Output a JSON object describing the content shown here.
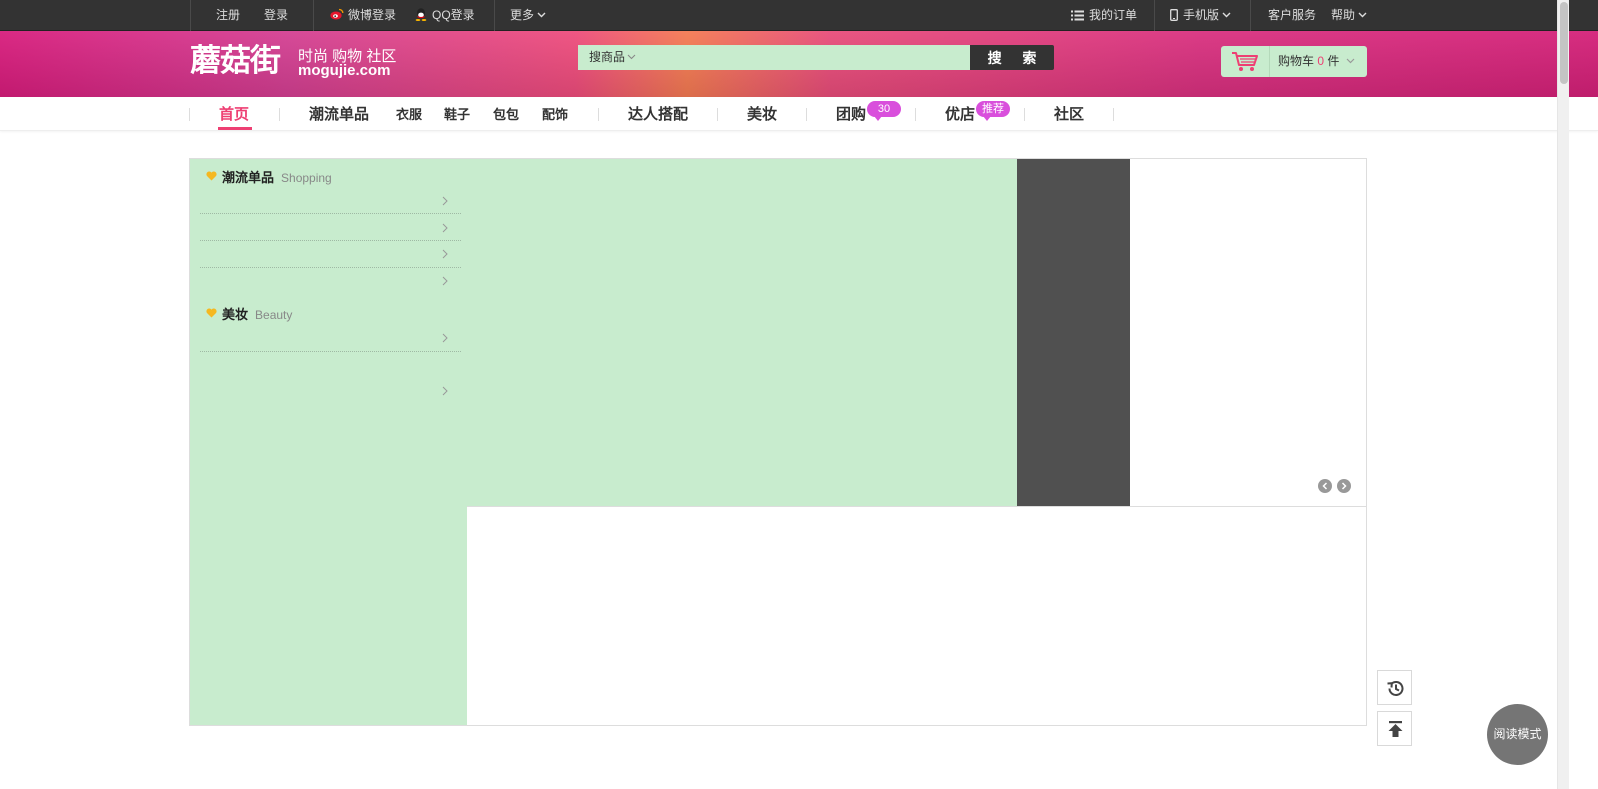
{
  "topbar": {
    "register": "注册",
    "login": "登录",
    "weibo_login": "微博登录",
    "qq_login": "QQ登录",
    "more": "更多",
    "my_orders": "我的订单",
    "mobile": "手机版",
    "customer_service": "客户服务",
    "help": "帮助"
  },
  "header": {
    "logo_text": "蘑菇街",
    "tagline": "时尚 购物 社区",
    "domain": "mogujie.com",
    "search": {
      "type_label": "搜商品",
      "placeholder": "",
      "button": "搜 索"
    },
    "cart": {
      "label": "购物车",
      "count": "0",
      "unit": "件"
    }
  },
  "nav": {
    "home": "首页",
    "trend_items": "潮流单品",
    "clothes": "衣服",
    "shoes": "鞋子",
    "bags": "包包",
    "accessories": "配饰",
    "expert_match": "达人搭配",
    "beauty": "美妆",
    "group_buy": "团购",
    "group_buy_badge": "30",
    "shops": "优店",
    "shops_badge": "推荐",
    "community": "社区"
  },
  "categories": [
    {
      "title": "潮流单品",
      "en": "Shopping"
    },
    {
      "title": "美妆",
      "en": "Beauty"
    }
  ],
  "side_tools": {
    "read_mode": "阅读模式"
  },
  "colors": {
    "accent_pink": "#ee3f73",
    "panel_green": "#c8ecce",
    "topbar": "#333333",
    "badge_purple": "#d94fdc"
  }
}
